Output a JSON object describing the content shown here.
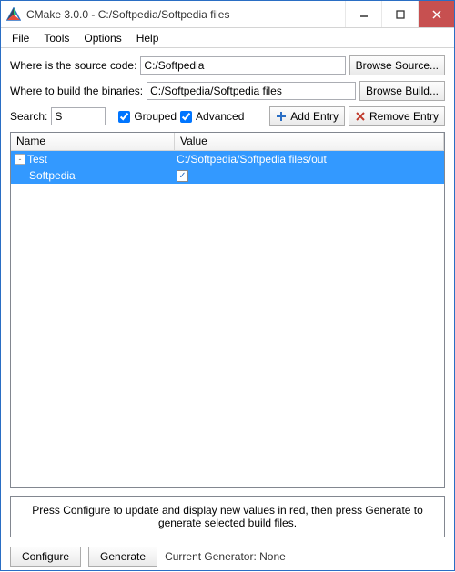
{
  "window": {
    "title": "CMake 3.0.0 - C:/Softpedia/Softpedia files"
  },
  "menu": {
    "file": "File",
    "tools": "Tools",
    "options": "Options",
    "help": "Help"
  },
  "labels": {
    "source": "Where is the source code:",
    "build": "Where to build the binaries:",
    "search": "Search:",
    "grouped": "Grouped",
    "advanced": "Advanced",
    "add_entry": "Add Entry",
    "remove_entry": "Remove Entry",
    "browse_source": "Browse Source...",
    "browse_build": "Browse Build...",
    "name_col": "Name",
    "value_col": "Value",
    "info": "Press Configure to update and display new values in red, then press Generate to generate selected build files.",
    "configure": "Configure",
    "generate": "Generate",
    "generator": "Current Generator: None"
  },
  "fields": {
    "source": "C:/Softpedia",
    "build": "C:/Softpedia/Softpedia files",
    "search": "S",
    "grouped_checked": true,
    "advanced_checked": true
  },
  "table": {
    "rows": [
      {
        "name": "Test",
        "value_type": "text",
        "value": "C:/Softpedia/Softpedia files/out",
        "selected": true
      },
      {
        "name": "Softpedia",
        "value_type": "checkbox",
        "checked": true,
        "selected": true
      }
    ]
  }
}
